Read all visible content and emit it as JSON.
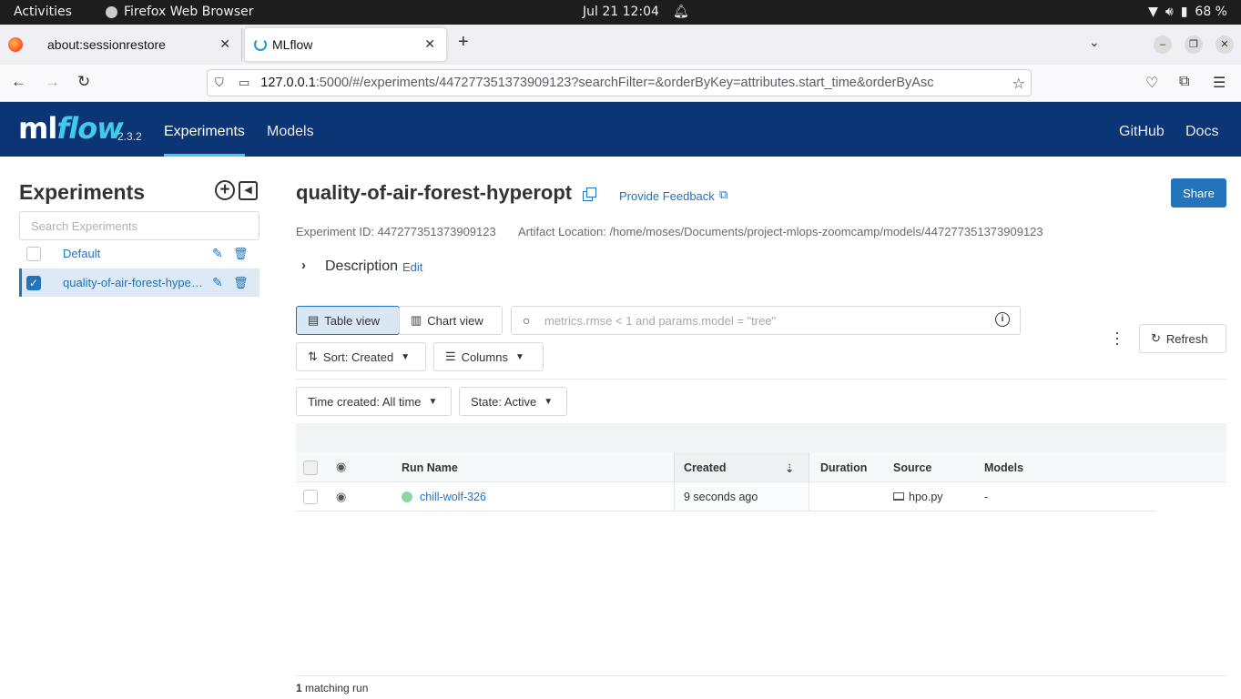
{
  "system_bar": {
    "activities": "Activities",
    "app_name": "Firefox Web Browser",
    "clock": "Jul 21  12:04",
    "battery": "68 %"
  },
  "browser": {
    "tabs": [
      {
        "label": "about:sessionrestore",
        "active": false
      },
      {
        "label": "MLflow",
        "active": true
      }
    ],
    "url_host": "127.0.0.1",
    "url_rest": ":5000/#/experiments/447277351373909123?searchFilter=&orderByKey=attributes.start_time&orderByAsc"
  },
  "mlflow": {
    "logo_ml": "ml",
    "logo_flow": "flow",
    "version": "2.3.2",
    "nav": {
      "experiments": "Experiments",
      "models": "Models",
      "github": "GitHub",
      "docs": "Docs"
    },
    "accent_color": "#2374bb",
    "header_color": "#0b3574"
  },
  "sidebar": {
    "title": "Experiments",
    "search_placeholder": "Search Experiments",
    "experiments": [
      {
        "name": "Default",
        "checked": false
      },
      {
        "name": "quality-of-air-forest-hyperopt",
        "checked": true
      }
    ]
  },
  "experiment": {
    "title": "quality-of-air-forest-hyperopt",
    "feedback_link": "Provide Feedback",
    "share_label": "Share",
    "id_text": "Experiment ID: 447277351373909123",
    "artifact_text": "Artifact Location: /home/moses/Documents/project-mlops-zoomcamp/models/447277351373909123",
    "description_label": "Description",
    "description_edit": "Edit"
  },
  "toolbar": {
    "table_view": "Table view",
    "chart_view": "Chart view",
    "search_placeholder": "metrics.rmse < 1 and params.model = \"tree\"",
    "refresh": "Refresh",
    "sort": "Sort: Created",
    "columns": "Columns",
    "time_filter": "Time created: All time",
    "state_filter": "State: Active"
  },
  "table": {
    "headers": {
      "run_name": "Run Name",
      "created": "Created",
      "duration": "Duration",
      "source": "Source",
      "models": "Models"
    },
    "rows": [
      {
        "run_name": "chill-wolf-326",
        "created": "9 seconds ago",
        "duration": "",
        "source": "hpo.py",
        "models": "-"
      }
    ]
  },
  "footer": {
    "count": "1",
    "count_suffix": " matching run"
  }
}
